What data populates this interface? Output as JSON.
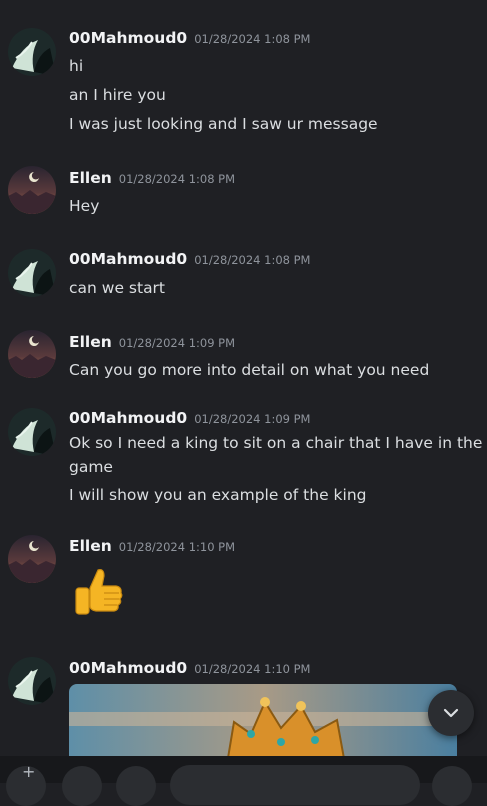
{
  "messages": [
    {
      "user": "00Mahmoud0",
      "time": "01/28/2024 1:08 PM",
      "lines": [
        "hi",
        "an I hire you",
        "I was just looking and I saw ur message"
      ]
    },
    {
      "user": "Ellen",
      "time": "01/28/2024 1:08 PM",
      "lines": [
        "Hey"
      ]
    },
    {
      "user": "00Mahmoud0",
      "time": "01/28/2024 1:08 PM",
      "lines": [
        "can we start"
      ]
    },
    {
      "user": "Ellen",
      "time": "01/28/2024 1:09 PM",
      "lines": [
        "Can you go more into detail on what you need"
      ]
    },
    {
      "user": "00Mahmoud0",
      "time": "01/28/2024 1:09 PM",
      "lines": [
        "Ok so I need a king to sit on a chair that I have in the",
        "game",
        "I will show you an example of the king"
      ]
    },
    {
      "user": "Ellen",
      "time": "01/28/2024 1:10 PM",
      "lines": []
    },
    {
      "user": "00Mahmoud0",
      "time": "01/28/2024 1:10 PM",
      "lines": []
    }
  ],
  "icons": {
    "scroll_down": "chevron-down-icon",
    "reaction": "thumbs-up-emoji"
  },
  "colors": {
    "background": "#1f2024",
    "username": "#f2f3f5",
    "timestamp": "#8f949c",
    "message_text": "#dbdee1"
  }
}
